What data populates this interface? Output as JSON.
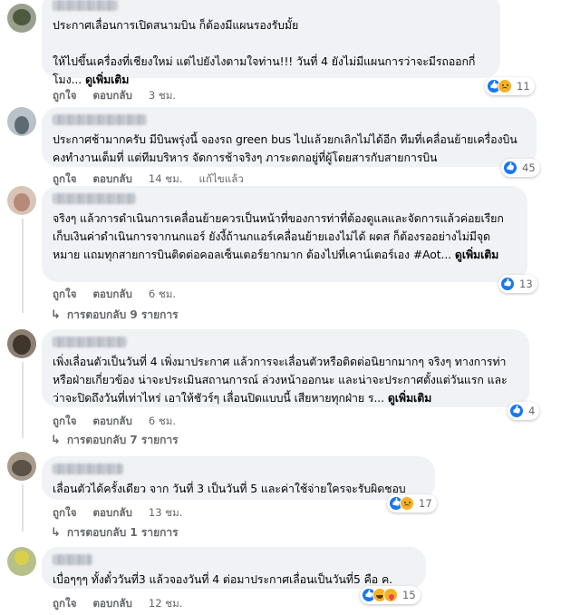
{
  "like_label": "ถูกใจ",
  "reply_label": "ตอบกลับ",
  "comments": [
    {
      "text": "ประกาศเลื่อนการเปิดสนามบิน ก็ต้องมีแผนรองรับมั้ย\n\nให้ไปขึ้นเครื่องที่เชียงใหม่ แต่ไปยังไงตามใจท่าน!!! วันที่ 4 ยังไม่มีแผนการว่าจะมีรถออกกี่โมง...",
      "more": "ดูเพิ่มเติม",
      "time": "3 ชม.",
      "edited": "",
      "reactions": [
        "like",
        "sad"
      ],
      "count": "11"
    },
    {
      "text": "ประกาศช้ามากครับ มีบินพรุ่งนี้ จองรถ green bus ไปแล้วยกเลิกไม่ได้อีก ทีมที่เคลื่อนย้ายเครื่องบินคงทำงานเต็มที่ แต่ทีมบริหาร จัดการช้าจริงๆ ภาระตกอยู่ที่ผู้โดยสารกับสายการบิน",
      "more": "",
      "time": "14 ชม.",
      "edited": "แก้ไขแล้ว",
      "reactions": [
        "like"
      ],
      "count": "45"
    },
    {
      "text": "จริงๆ แล้วการดำเนินการเคลื่อนย้ายควรเป็นหน้าที่ของการท่าที่ต้องดูแลและจัดการแล้วค่อยเรียกเก็บเงินค่าดำเนินการจากนกแอร์ ยังงี้ถ้านกแอร์เคลื่อนย้ายเองไม่ได้ ผดส ก็ต้องรออย่างไม่มีจุดหมาย แถมทุกสายการบินติดต่อคอลเซ็นเตอร์ยากมาก ต้องไปที่เคาน์เตอร์เอง #Aot...",
      "more": "ดูเพิ่มเติม",
      "time": "6 ชม.",
      "edited": "",
      "reactions": [
        "like"
      ],
      "count": "13",
      "replies": "การตอบกลับ 9 รายการ"
    },
    {
      "text": "เพิ่งเลื่อนตัวเป็นวันที่ 4 เพิ่งมาประกาศ แล้วการจะเลื่อนตัวหรือติดต่อนิยากมากๆ จริงๆ ทางการท่าหรือฝ่ายเกี่ยวข้อง น่าจะประเมินสถานการณ์ ล่วงหน้าออกนะ และน่าจะประกาศตั้งแต่วันแรก และ ว่าจะปิดถึงวันที่เท่าไหร่ เอาให้ชัวร์ๆ เลื่อนปิดแบบนี้ เสียหายทุกฝ่าย ร...",
      "more": "ดูเพิ่มเติม",
      "time": "6 ชม.",
      "edited": "",
      "reactions": [
        "like"
      ],
      "count": "4",
      "replies": "การตอบกลับ 7 รายการ"
    },
    {
      "text": "เลื่อนตัวได้ครั้งเดียว จาก วันที่ 3 เป็นวันที่ 5 และค่าใช้จ่ายใครจะรับผิดชอบ",
      "more": "",
      "time": "13 ชม.",
      "edited": "",
      "reactions": [
        "like",
        "sad"
      ],
      "count": "17",
      "replies": "การตอบกลับ 1 รายการ"
    },
    {
      "text": "เบื่อๆๆๆ ทั้งตั๋ววันที่3 แล้วจองวันที่ 4 ต่อมาประกาศเลื่อนเป็นวันที่5 คือ ค.",
      "more": "",
      "time": "12 ชม.",
      "edited": "",
      "reactions": [
        "like",
        "haha",
        "care"
      ],
      "count": "15"
    }
  ]
}
